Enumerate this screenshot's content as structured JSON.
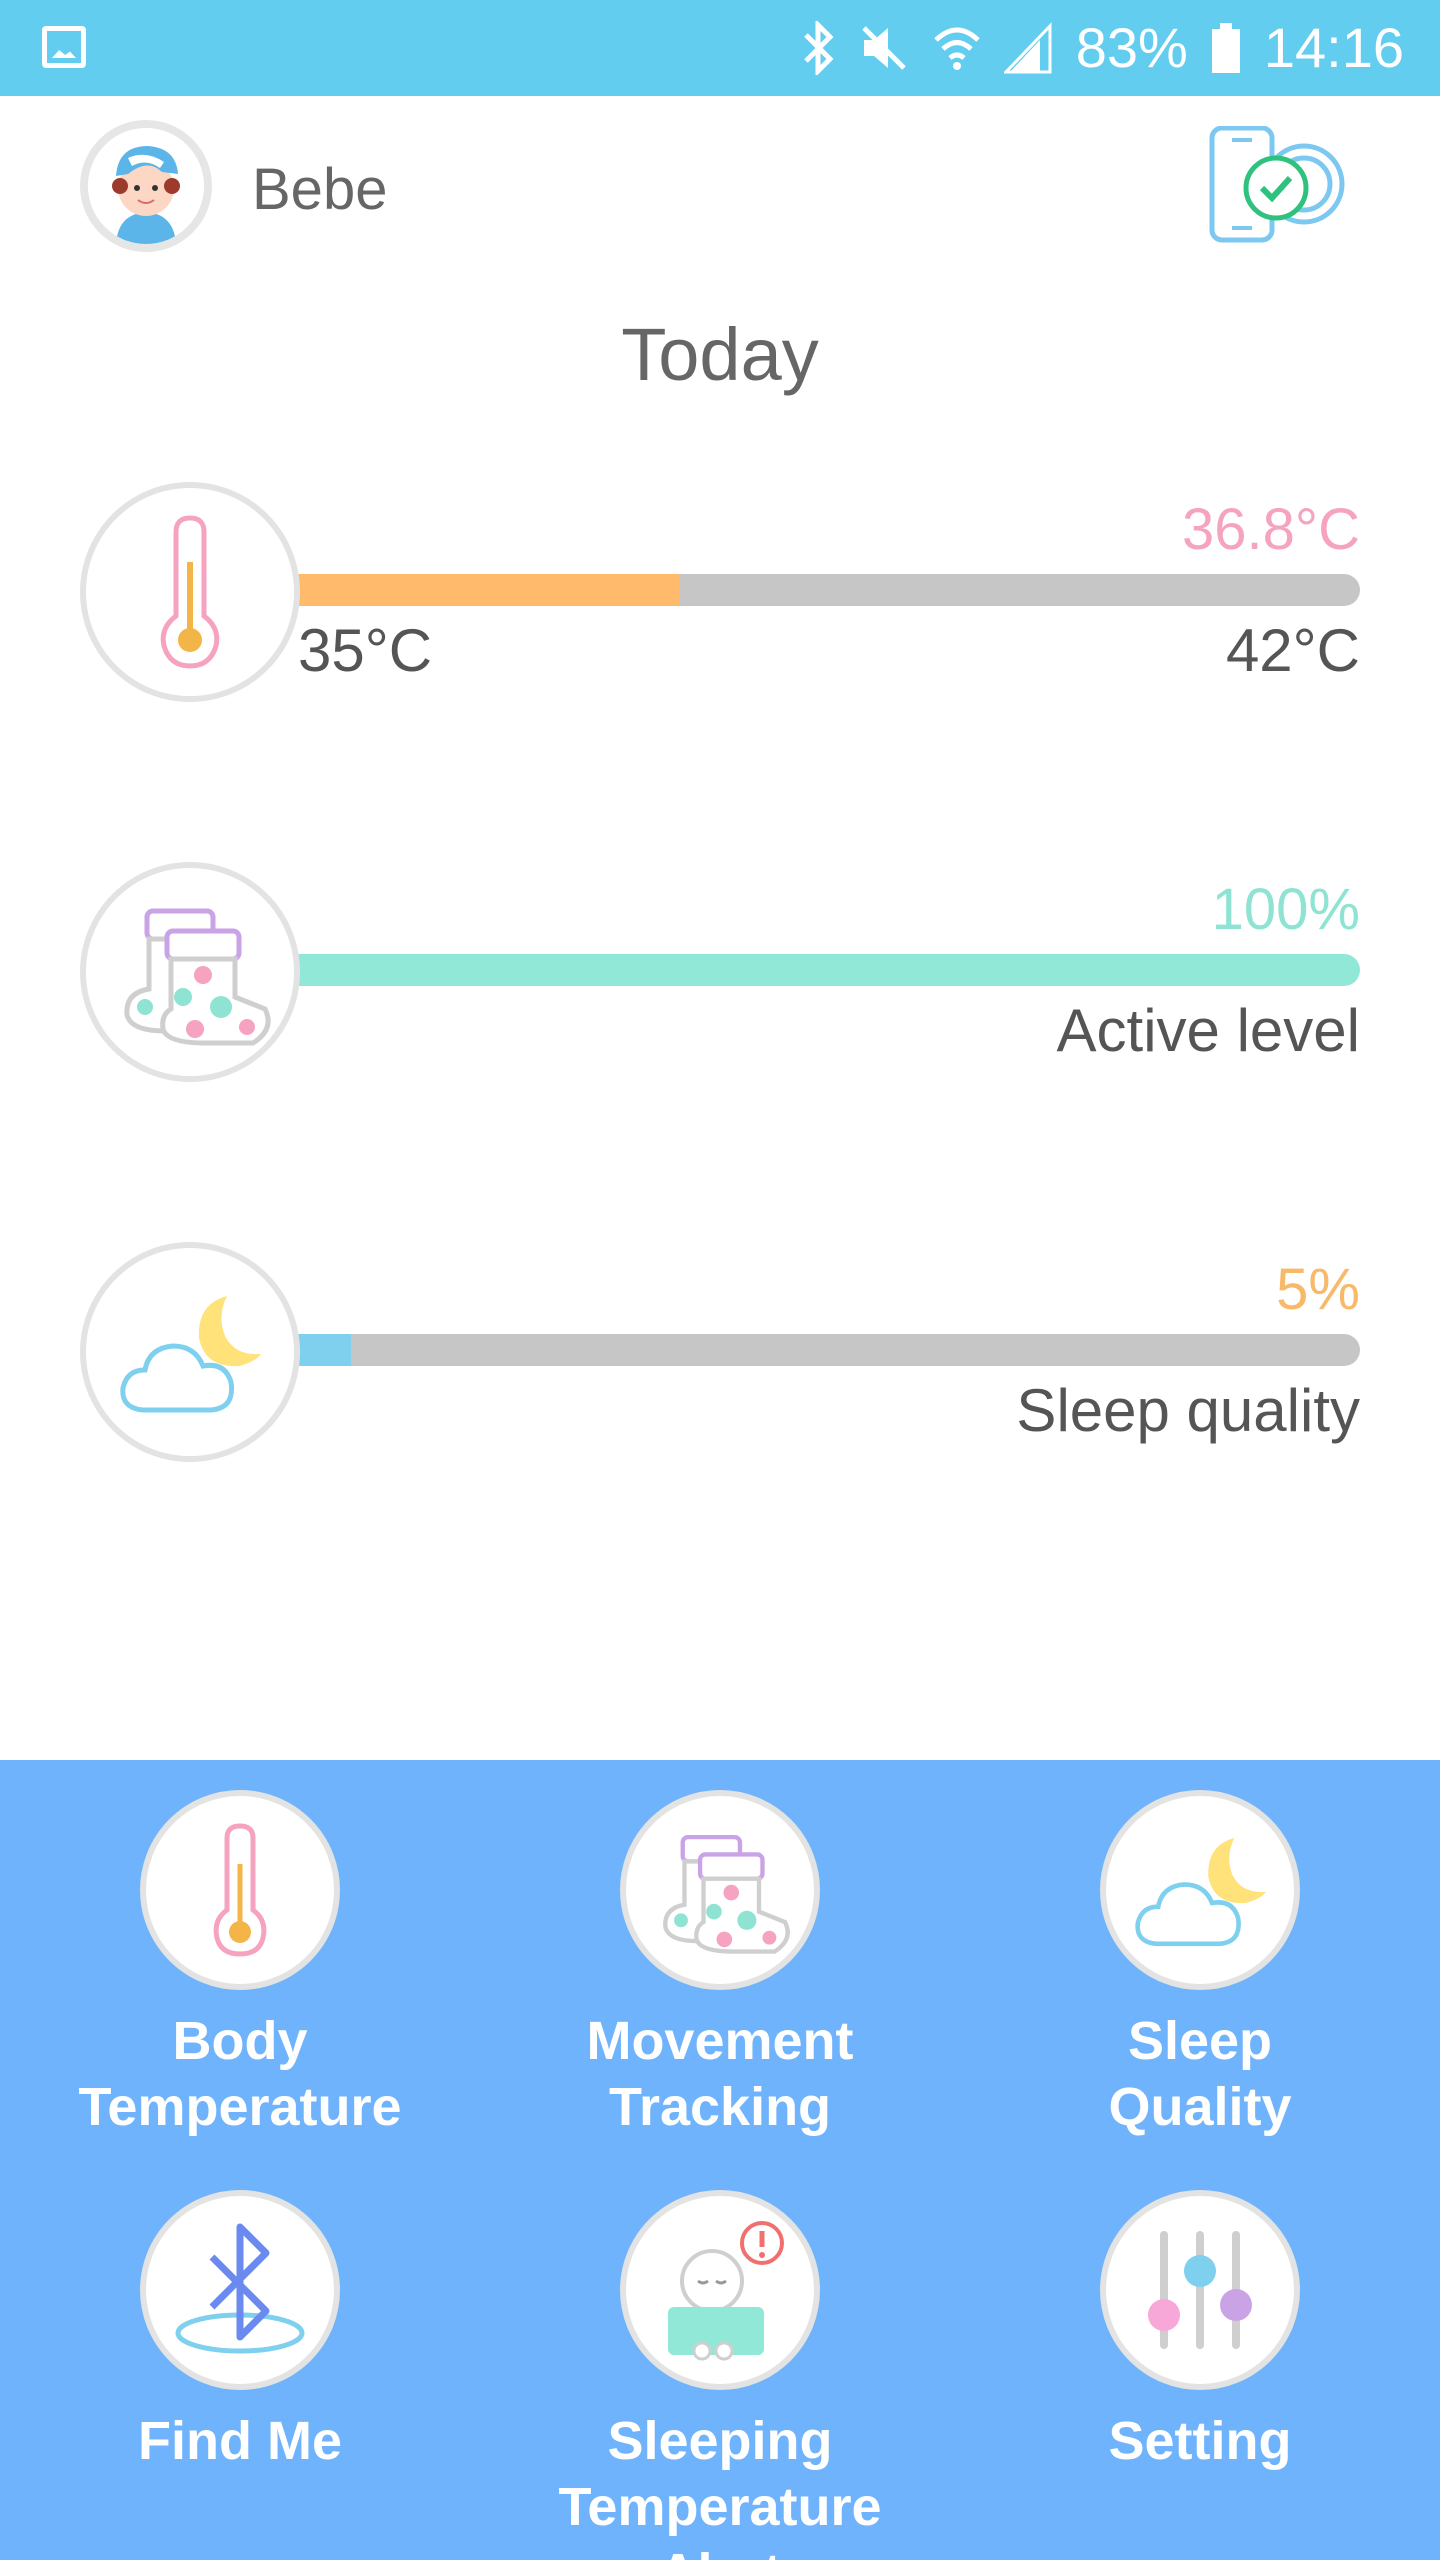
{
  "status_bar": {
    "battery": "83%",
    "time": "14:16",
    "icons": [
      "gallery-icon",
      "bluetooth-icon",
      "mute-icon",
      "wifi-icon",
      "signal-icon",
      "battery-icon"
    ]
  },
  "header": {
    "user_name": "Bebe",
    "avatar_icon": "baby-avatar-icon",
    "device_icon": "device-connected-icon"
  },
  "title": "Today",
  "stats": {
    "temperature": {
      "icon": "thermometer-icon",
      "value": "36.8°C",
      "min": "35°C",
      "max": "42°C",
      "fill_fraction": 0.36,
      "value_color": "#F5A3C0",
      "fill_color": "#FFBA6B"
    },
    "activity": {
      "icon": "booties-icon",
      "value": "100%",
      "label": "Active level",
      "fill_fraction": 1.0,
      "value_color": "#8FE3D2",
      "fill_color": "#92E8D6"
    },
    "sleep": {
      "icon": "moon-cloud-icon",
      "value": "5%",
      "label": "Sleep quality",
      "fill_fraction": 0.05,
      "value_color": "#F7B96A",
      "fill_color": "#7ED0EE"
    }
  },
  "menu": {
    "items": [
      {
        "line1": "Body",
        "line2": "Temperature",
        "icon": "thermometer-icon"
      },
      {
        "line1": "Movement",
        "line2": "Tracking",
        "icon": "booties-icon"
      },
      {
        "line1": "Sleep",
        "line2": "Quality",
        "icon": "moon-cloud-icon"
      },
      {
        "line1": "Find Me",
        "line2": "",
        "icon": "bluetooth-icon"
      },
      {
        "line1": "Sleeping",
        "line2": "Temperature Alert",
        "icon": "sleeping-baby-alert-icon"
      },
      {
        "line1": "Setting",
        "line2": "",
        "icon": "sliders-icon"
      }
    ]
  },
  "colors": {
    "status_bar": "#63CDEF",
    "menu_background": "#6EB3FB",
    "track": "#C6C6C6"
  }
}
